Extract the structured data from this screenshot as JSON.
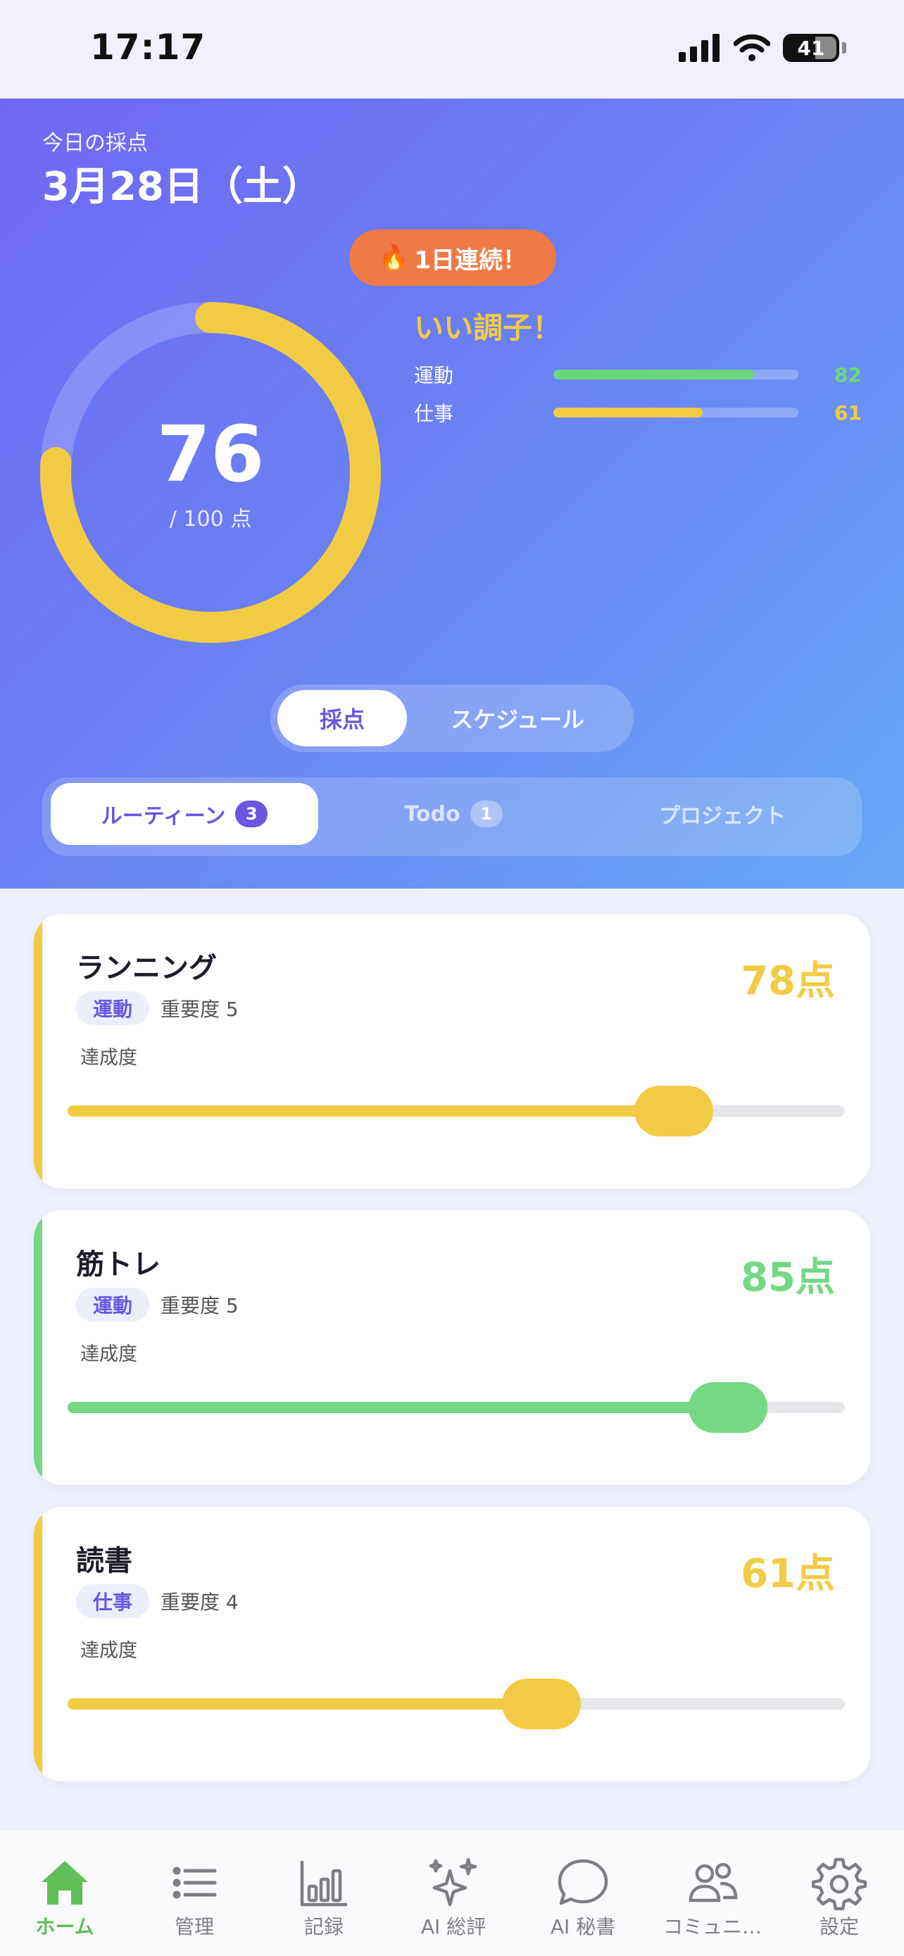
{
  "status_bar": {
    "time": "17:17",
    "battery": "41"
  },
  "hero": {
    "label": "今日の採点",
    "date": "3月28日（土）",
    "streak": "1日連続！",
    "score": "76",
    "score_suffix": "/ 100 点",
    "score_fraction": 0.76,
    "mood": "いい調子！",
    "categories": [
      {
        "name": "運動",
        "value": "82",
        "fraction": 0.82,
        "color": "#6ad87a"
      },
      {
        "name": "仕事",
        "value": "61",
        "fraction": 0.61,
        "color": "#f2cb45"
      }
    ]
  },
  "segment": {
    "active": "採点",
    "other": "スケジュール"
  },
  "tabs": [
    {
      "label": "ルーティーン",
      "count": "3"
    },
    {
      "label": "Todo",
      "count": "1"
    },
    {
      "label": "プロジェクト"
    }
  ],
  "cards": [
    {
      "title": "ランニング",
      "tag": "運動",
      "importance": "重要度 5",
      "score": "78点",
      "achievement_label": "達成度",
      "value": 78,
      "color": "#f2cb45"
    },
    {
      "title": "筋トレ",
      "tag": "運動",
      "importance": "重要度 5",
      "score": "85点",
      "achievement_label": "達成度",
      "value": 85,
      "color": "#74d884"
    },
    {
      "title": "読書",
      "tag": "仕事",
      "importance": "重要度 4",
      "score": "61点",
      "achievement_label": "達成度",
      "value": 61,
      "color": "#f2cb45"
    }
  ],
  "nav": [
    {
      "label": "ホーム",
      "icon": "home-icon",
      "active": true
    },
    {
      "label": "管理",
      "icon": "list-icon"
    },
    {
      "label": "記録",
      "icon": "bar-chart-icon"
    },
    {
      "label": "AI 総評",
      "icon": "sparkles-icon"
    },
    {
      "label": "AI 秘書",
      "icon": "chat-bubble-icon"
    },
    {
      "label": "コミュニ…",
      "icon": "people-icon"
    },
    {
      "label": "設定",
      "icon": "gear-icon"
    }
  ],
  "colors": {
    "accent": "#6a56e0",
    "active_nav": "#5fbf58",
    "streak": "#ef7a45"
  }
}
